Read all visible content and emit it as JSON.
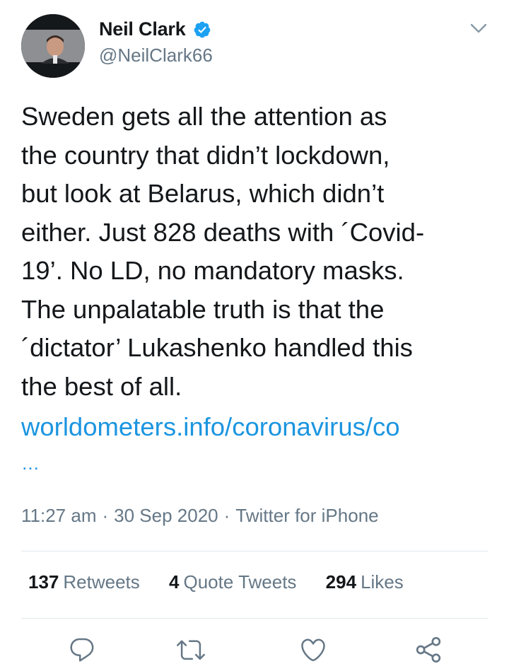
{
  "author": {
    "display_name": "Neil Clark",
    "handle": "@NeilClark66",
    "verified": true
  },
  "tweet": {
    "text": "Sweden gets all the attention as\nthe country that didn’t lockdown,\nbut look at Belarus, which didn’t\neither. Just 828 deaths with ´Covid-\n19’. No LD, no mandatory masks.\nThe unpalatable truth is that the\n´dictator’ Lukashenko handled this\nthe best of all.",
    "link": "worldometers.info/coronavirus/co",
    "link_more": "…"
  },
  "meta": {
    "time": "11:27 am",
    "date": "30 Sep 2020",
    "source": "Twitter for iPhone",
    "separator": "·"
  },
  "stats": {
    "retweets_count": "137",
    "retweets_label": "Retweets",
    "quotes_count": "4",
    "quotes_label": "Quote Tweets",
    "likes_count": "294",
    "likes_label": "Likes"
  },
  "actions": [
    "reply-icon",
    "retweet-icon",
    "like-icon",
    "share-icon"
  ],
  "colors": {
    "link": "#1b95e0",
    "verified": "#1da1f2",
    "secondary_text": "#657786",
    "divider": "#e1e8ed"
  }
}
